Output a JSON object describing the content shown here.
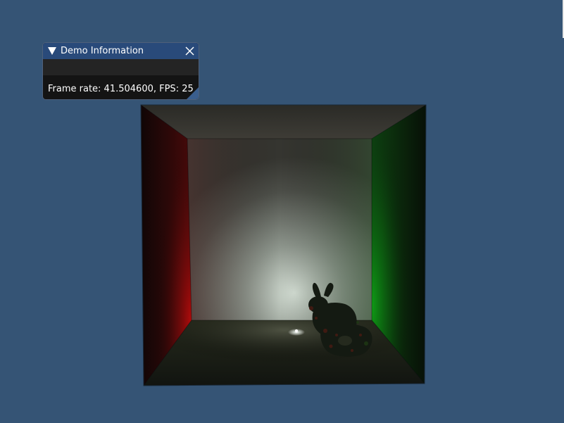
{
  "window": {
    "title": "Demo Information",
    "frame_rate_text": "Frame rate: 41.504600, FPS: 25"
  },
  "colors": {
    "background": "#355475",
    "titlebar": "#294a7a",
    "panel_body": "#141414",
    "left_wall": "#c00c0c",
    "right_wall": "#0fa016"
  },
  "icons": {
    "collapse": "collapse-triangle-icon",
    "close": "close-x-icon",
    "resize": "resize-grip-icon"
  }
}
